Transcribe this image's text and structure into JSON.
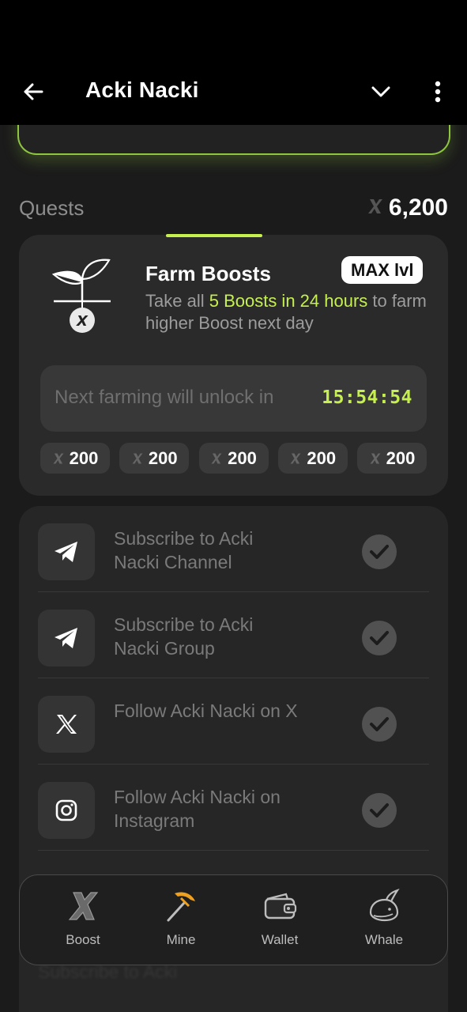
{
  "header": {
    "title": "Acki Nacki"
  },
  "quests": {
    "label": "Quests",
    "total": "6,200"
  },
  "farm": {
    "title": "Farm Boosts",
    "badge": "MAX lvl",
    "desc_prefix": "Take all ",
    "desc_highlight": "5 Boosts in 24 hours",
    "desc_suffix": " to farm higher Boost next day",
    "unlock_text": "Next farming will unlock in",
    "timer": "15:54:54",
    "chips": [
      "200",
      "200",
      "200",
      "200",
      "200"
    ]
  },
  "tasks": [
    {
      "label": "Subscribe to Acki Nacki Channel",
      "icon": "telegram-icon",
      "done": true
    },
    {
      "label": "Subscribe to Acki Nacki Group",
      "icon": "telegram-icon",
      "done": true
    },
    {
      "label": "Follow Acki Nacki on X",
      "icon": "x-logo-icon",
      "done": true
    },
    {
      "label": "Follow Acki Nacki on Instagram",
      "icon": "instagram-icon",
      "done": true
    }
  ],
  "ghost_tasks": [
    {
      "label": "Subscribe to Acki"
    }
  ],
  "nav": {
    "boost": "Boost",
    "mine": "Mine",
    "wallet": "Wallet",
    "whale": "Whale"
  },
  "colors": {
    "accent": "#c6f04e",
    "background": "#1b1b1b",
    "card": "#2a2a2a"
  }
}
